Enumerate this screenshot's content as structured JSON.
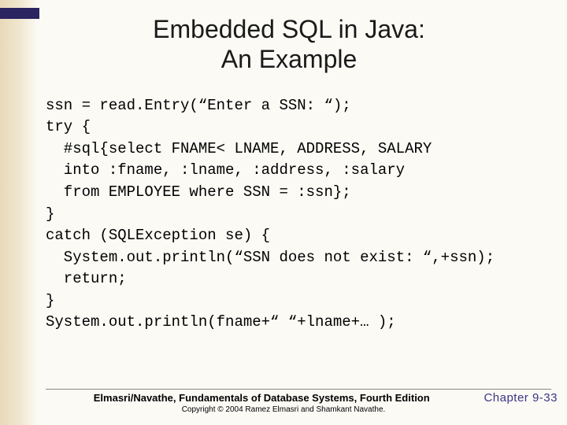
{
  "title_line1": "Embedded SQL in Java:",
  "title_line2": "An Example",
  "code": "ssn = read.Entry(“Enter a SSN: “);\ntry {\n  #sql{select FNAME< LNAME, ADDRESS, SALARY\n  into :fname, :lname, :address, :salary\n  from EMPLOYEE where SSN = :ssn};\n}\ncatch (SQLException se) {\n  System.out.println(“SSN does not exist: “,+ssn);\n  return;\n}\nSystem.out.println(fname+“ “+lname+… );",
  "footer": {
    "book": "Elmasri/Navathe, Fundamentals of Database Systems, Fourth Edition",
    "chapter": "Chapter 9-33",
    "copyright": "Copyright © 2004 Ramez Elmasri and Shamkant Navathe."
  }
}
